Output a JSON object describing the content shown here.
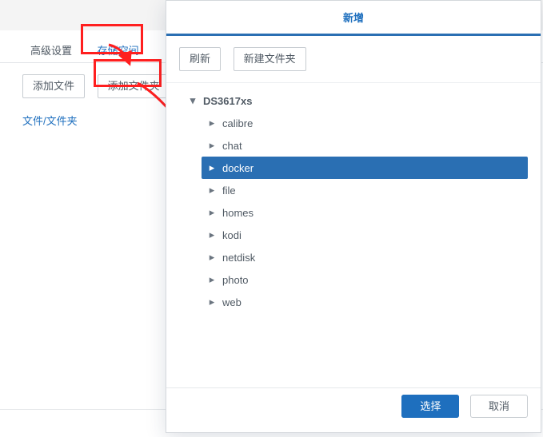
{
  "back": {
    "title": "高级设置",
    "tabs": [
      "高级设置",
      "存储空间"
    ],
    "active_tab_index": 1,
    "add_file": "添加文件",
    "add_folder": "添加文件夹",
    "list_header": "文件/文件夹"
  },
  "front": {
    "title": "新增",
    "refresh": "刷新",
    "new_folder": "新建文件夹",
    "root": "DS3617xs",
    "children": [
      "calibre",
      "chat",
      "docker",
      "file",
      "homes",
      "kodi",
      "netdisk",
      "photo",
      "web"
    ],
    "selected_index": 2,
    "select": "选择",
    "cancel": "取消"
  }
}
